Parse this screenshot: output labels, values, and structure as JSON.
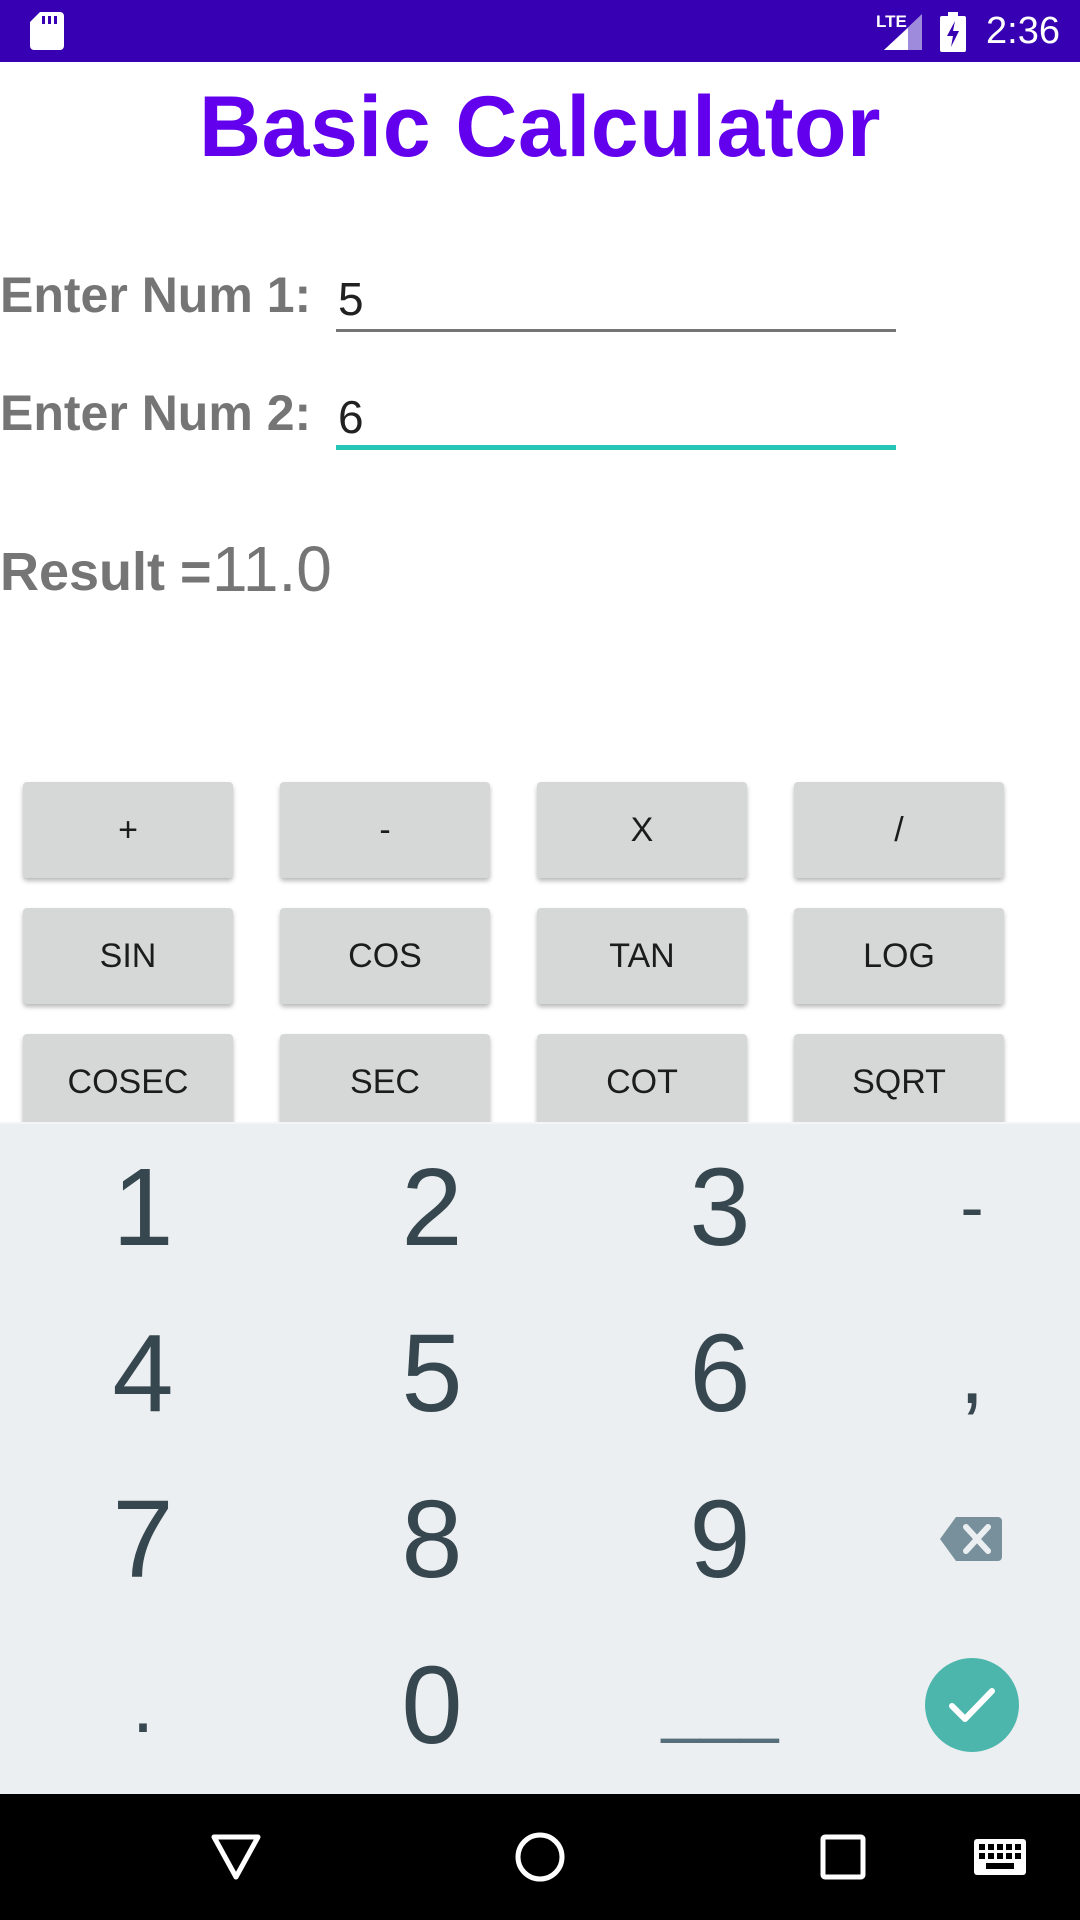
{
  "status_bar": {
    "network_label": "LTE",
    "time": "2:36",
    "icons": [
      "sd-card-icon",
      "signal-icon",
      "battery-charging-icon"
    ]
  },
  "app": {
    "title": "Basic Calculator",
    "num1_label": "Enter Num 1:",
    "num1_value": "5",
    "num2_label": "Enter Num 2:",
    "num2_value": "6",
    "result_label": "Result =",
    "result_value": "11.0"
  },
  "operations": {
    "row1": [
      "+",
      "-",
      "X",
      "/"
    ],
    "row2": [
      "SIN",
      "COS",
      "TAN",
      "LOG"
    ],
    "row3": [
      "COSEC",
      "SEC",
      "COT",
      "SQRT"
    ]
  },
  "keyboard": {
    "keys": {
      "k1": "1",
      "k2": "2",
      "k3": "3",
      "minus": "-",
      "k4": "4",
      "k5": "5",
      "k6": "6",
      "comma": ",",
      "k7": "7",
      "k8": "8",
      "k9": "9",
      "dot": ".",
      "k0": "0",
      "space": "___"
    },
    "icons": [
      "backspace-icon",
      "check-icon"
    ]
  },
  "nav_bar": {
    "icons": [
      "back-icon",
      "home-icon",
      "recents-icon",
      "keyboard-icon"
    ]
  },
  "colors": {
    "status_bar": "#3700b3",
    "title": "#6200ee",
    "input_focus": "#26c6b6",
    "done_button": "#4db6ac",
    "keyboard_bg": "#eceff1"
  }
}
